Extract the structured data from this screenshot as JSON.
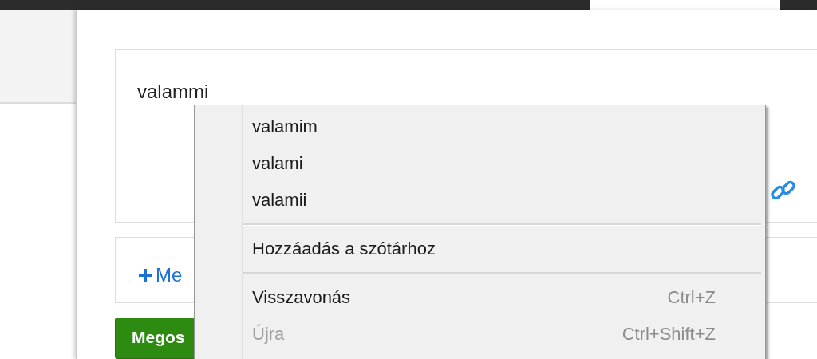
{
  "editor": {
    "value": "valammi"
  },
  "add_link": {
    "label": "Me"
  },
  "share_button": {
    "label": "Megos"
  },
  "context_menu": {
    "items": [
      {
        "kind": "suggestion",
        "label": "valamim"
      },
      {
        "kind": "suggestion",
        "label": "valami"
      },
      {
        "kind": "suggestion",
        "label": "valamii"
      },
      {
        "kind": "separator"
      },
      {
        "kind": "command",
        "label": "Hozzáadás a szótárhoz",
        "disabled": false
      },
      {
        "kind": "separator"
      },
      {
        "kind": "command",
        "label": "Visszavonás",
        "shortcut": "Ctrl+Z",
        "disabled": false
      },
      {
        "kind": "command",
        "label": "Újra",
        "shortcut": "Ctrl+Shift+Z",
        "disabled": true
      }
    ]
  }
}
